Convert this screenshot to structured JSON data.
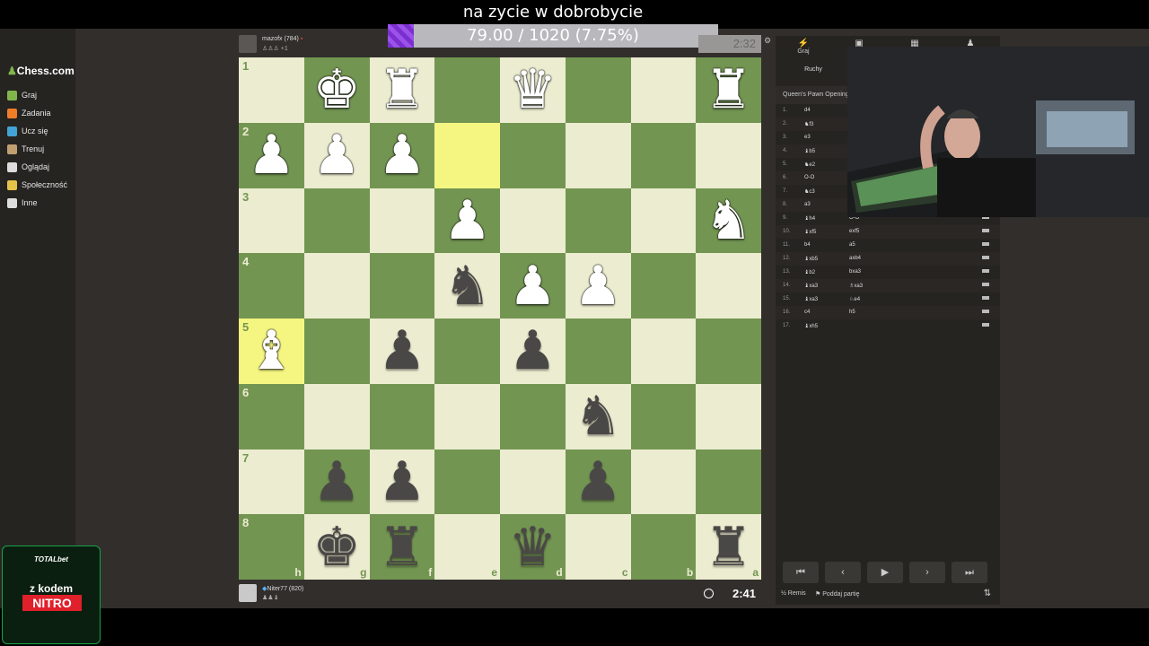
{
  "overlay": {
    "title": "na zycie w dobrobycie",
    "progress_text": "79.00 / 1020 (7.75%)",
    "progress_fraction": 0.0775
  },
  "sidebar": {
    "logo": "Chess.com",
    "items": [
      {
        "label": "Graj",
        "icon": "play-icon",
        "color": "#81b64c"
      },
      {
        "label": "Zadania",
        "icon": "puzzle-icon",
        "color": "#f07e28"
      },
      {
        "label": "Ucz się",
        "icon": "learn-icon",
        "color": "#42a4d6"
      },
      {
        "label": "Trenuj",
        "icon": "train-icon",
        "color": "#c0a070"
      },
      {
        "label": "Oglądaj",
        "icon": "watch-icon",
        "color": "#dddddd"
      },
      {
        "label": "Społeczność",
        "icon": "community-icon",
        "color": "#e6c44a"
      },
      {
        "label": "Inne",
        "icon": "more-icon",
        "color": "#dddddd"
      }
    ]
  },
  "top_player": {
    "name": "mazofx",
    "rating": "(784)",
    "captured": "+1",
    "clock": "2:32"
  },
  "bottom_player": {
    "name": "Niter77",
    "rating": "(820)",
    "clock": "2:41"
  },
  "board": {
    "ranks": [
      "1",
      "2",
      "3",
      "4",
      "5",
      "6",
      "7",
      "8"
    ],
    "files": [
      "h",
      "g",
      "f",
      "e",
      "d",
      "c",
      "b",
      "a"
    ],
    "light_color": "#ebecd0",
    "dark_color": "#739552",
    "highlight_color": "#f5f682",
    "rows": [
      [
        "",
        "wK",
        "wR",
        "",
        "wQ",
        "",
        "",
        "wR"
      ],
      [
        "wP",
        "wP",
        "wP",
        "",
        "",
        "",
        "",
        ""
      ],
      [
        "",
        "",
        "",
        "wP",
        "",
        "",
        "",
        "wN"
      ],
      [
        "",
        "",
        "",
        "bN",
        "wP",
        "wP",
        "",
        ""
      ],
      [
        "wB",
        "",
        "bP",
        "",
        "bP",
        "",
        "",
        ""
      ],
      [
        "",
        "",
        "",
        "",
        "",
        "bN",
        "",
        ""
      ],
      [
        "",
        "bP",
        "bP",
        "",
        "",
        "bP",
        "",
        ""
      ],
      [
        "",
        "bK",
        "bR",
        "",
        "bQ",
        "",
        "",
        "bR"
      ]
    ],
    "highlights": [
      [
        1,
        3
      ],
      [
        4,
        0
      ]
    ]
  },
  "panel": {
    "tabs": [
      {
        "label": "Graj",
        "icon": "lightning-icon"
      },
      {
        "label": "N",
        "icon": "chat-icon"
      },
      {
        "label": "",
        "icon": "board-icon"
      },
      {
        "label": "",
        "icon": "friends-icon"
      }
    ],
    "sub_tab": "Ruchy",
    "opening": "Queen's Pawn Opening: Z",
    "moves": [
      {
        "n": "1.",
        "w": "d4",
        "b": ""
      },
      {
        "n": "2.",
        "w": "♞f3",
        "b": ""
      },
      {
        "n": "3.",
        "w": "e3",
        "b": ""
      },
      {
        "n": "4.",
        "w": "♝b5",
        "b": ""
      },
      {
        "n": "5.",
        "w": "♞e2",
        "b": ""
      },
      {
        "n": "6.",
        "w": "O-O",
        "b": ""
      },
      {
        "n": "7.",
        "w": "♞c3",
        "b": ""
      },
      {
        "n": "8.",
        "w": "a3",
        "b": ""
      },
      {
        "n": "9.",
        "w": "♝h4",
        "b": "O-O"
      },
      {
        "n": "10.",
        "w": "♝xf5",
        "b": "exf5"
      },
      {
        "n": "11.",
        "w": "b4",
        "b": "a5"
      },
      {
        "n": "12.",
        "w": "♝xb5",
        "b": "axb4"
      },
      {
        "n": "13.",
        "w": "♝b2",
        "b": "bxa3"
      },
      {
        "n": "14.",
        "w": "♝xa3",
        "b": "♗xa3"
      },
      {
        "n": "15.",
        "w": "♝xa3",
        "b": "♘e4"
      },
      {
        "n": "16.",
        "w": "c4",
        "b": "h5"
      },
      {
        "n": "17.",
        "w": "♝xh5",
        "b": ""
      }
    ],
    "controls": [
      "first-icon",
      "prev-icon",
      "next-icon",
      "next2-icon",
      "last-icon"
    ],
    "draw_label": "Remis",
    "resign_label": "Poddaj partię",
    "half": "½"
  },
  "sponsor": {
    "brand": "TOTALbet",
    "line1": "z kodem",
    "line2": "NITRO"
  }
}
